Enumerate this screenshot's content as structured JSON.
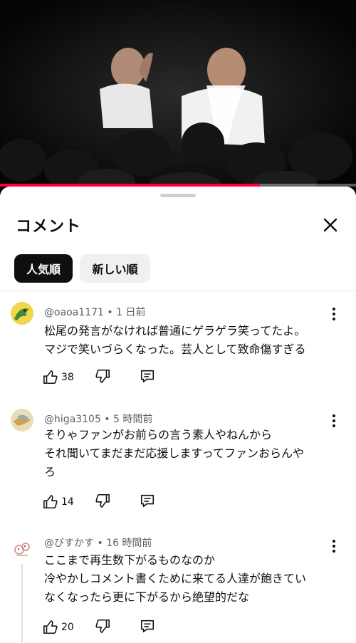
{
  "player": {
    "progress_fraction": 0.73
  },
  "panel": {
    "title": "コメント",
    "close_icon": "close-icon",
    "sort_chips": [
      {
        "label": "人気順",
        "selected": true
      },
      {
        "label": "新しい順",
        "selected": false
      }
    ]
  },
  "comments": [
    {
      "author": "@oaoa1171",
      "time": "1 日前",
      "lines": [
        "松尾の発言がなければ普通にゲラゲラ笑ってたよ。",
        "マジで笑いづらくなった。芸人として致命傷すぎる"
      ],
      "likes": "38"
    },
    {
      "author": "@higa3105",
      "time": "5 時間前",
      "lines": [
        "そりゃファンがお前らの言う素人やねんから",
        "それ聞いてまだまだ応援しますってファンおらんや",
        "ろ"
      ],
      "likes": "14"
    },
    {
      "author": "@びすかす",
      "time": "16 時間前",
      "lines": [
        "ここまで再生数下がるものなのか",
        "冷やかしコメント書くために来てる人達が飽きてい",
        "なくなったら更に下がるから絶望的だな"
      ],
      "likes": "20"
    }
  ],
  "icons": {
    "like": "thumb-up-icon",
    "dislike": "thumb-down-icon",
    "reply": "reply-icon",
    "more": "more-vert-icon"
  },
  "colors": {
    "accent": "#ff0033",
    "chip_selected_bg": "#0f0f0f",
    "chip_bg": "#f0f0f0",
    "meta_text": "#606060"
  }
}
